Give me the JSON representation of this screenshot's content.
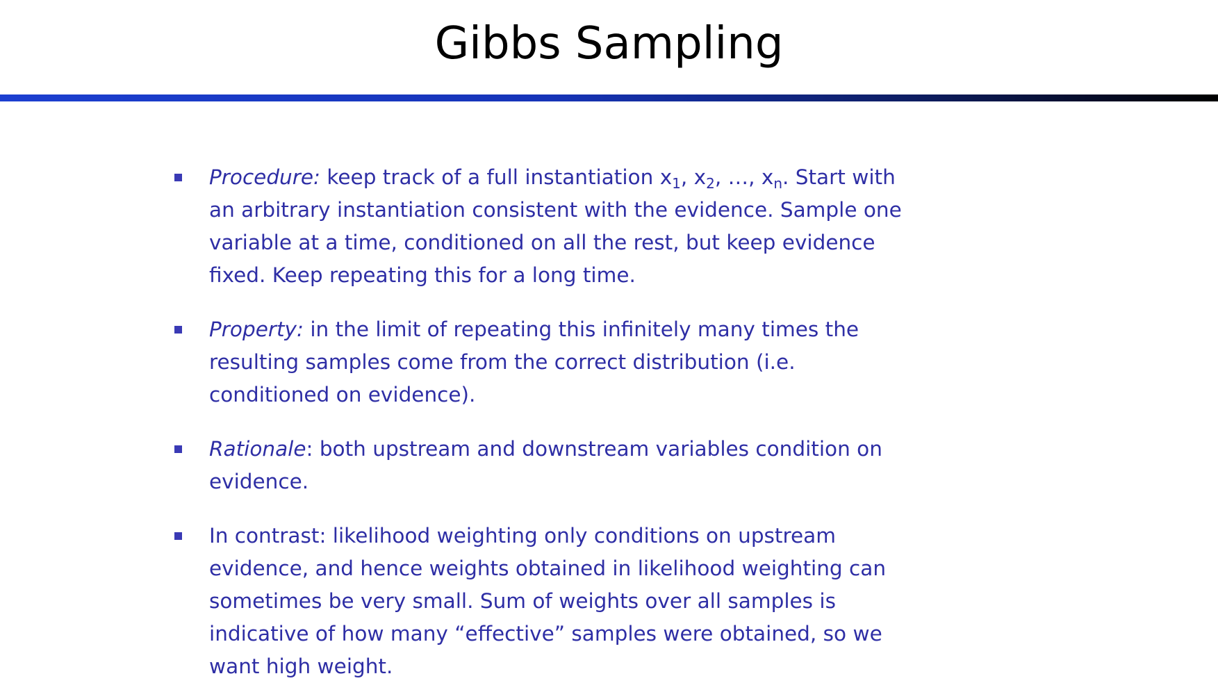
{
  "title": "Gibbs Sampling",
  "colors": {
    "title": "#000000",
    "body_text": "#2e2ea5",
    "bullet_marker": "#3a3ab5",
    "rule_start": "#1c3fd0",
    "rule_end": "#000000"
  },
  "bullets": [
    {
      "term": "Procedure:",
      "text_1": " keep track of a full instantiation x",
      "sub_1": "1",
      "text_2": ", x",
      "sub_2": "2",
      "text_3": ", …, x",
      "sub_3": "n",
      "text_4": ".   Start with an arbitrary instantiation consistent with the evidence.  Sample one variable at a time, conditioned on all the rest, but keep evidence fixed.  Keep repeating this for a long time."
    },
    {
      "term": "Property:",
      "text": " in the limit of repeating this infinitely many times the resulting samples come from the correct distribution (i.e. conditioned on evidence)."
    },
    {
      "term": "Rationale",
      "text": ": both upstream and downstream variables condition on evidence."
    },
    {
      "text": "In contrast: likelihood weighting only conditions on upstream evidence, and hence weights obtained in likelihood weighting can sometimes be very small.  Sum of weights over all samples is indicative of how many “effective” samples were obtained, so we want high weight."
    }
  ]
}
